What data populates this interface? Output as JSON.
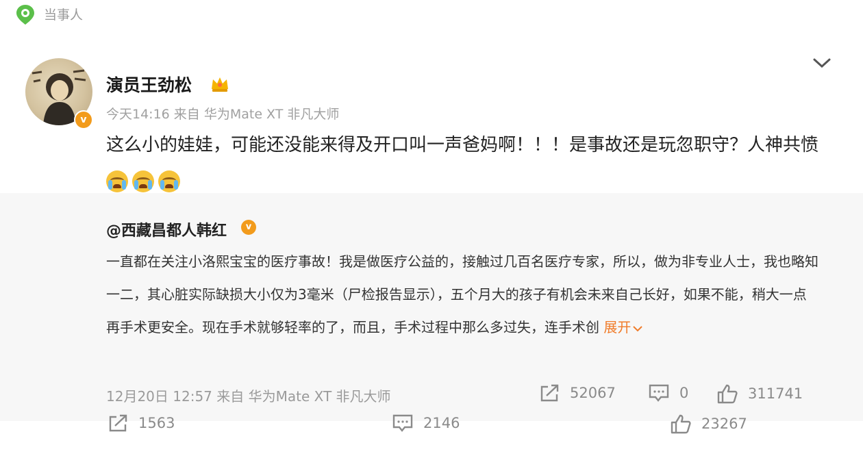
{
  "topbar": {
    "title": "当事人",
    "icon": "location-badge-icon"
  },
  "post": {
    "author": "演员王劲松",
    "meta": "今天14:16  来自 华为Mate XT 非凡大师",
    "content": "这么小的娃娃，可能还没能来得及开口叫一声爸妈啊！！！是事故还是玩忽职守？人神共愤",
    "emojis": [
      "cry-emoji",
      "cry-emoji",
      "cry-emoji"
    ],
    "repost": {
      "user": "@西藏昌都人韩红",
      "text": "一直都在关注小洛熙宝宝的医疗事故！我是做医疗公益的，接触过几百名医疗专家，所以，做为非专业人士，我也略知一二，其心脏实际缺损大小仅为3毫米（尸检报告显示），五个月大的孩子有机会未来自己长好，如果不能，稍大一点再手术更安全。现在手术就够轻率的了，而且，手术过程中那么多过失，连手术创",
      "expand_label": "展开",
      "meta": "12月20日 12:57 来自 华为Mate XT 非凡大师",
      "stats": {
        "reposts": "52067",
        "comments": "0",
        "likes": "311741"
      }
    },
    "stats": {
      "reposts": "1563",
      "comments": "2146",
      "likes": "23267"
    }
  },
  "colors": {
    "accent": "#f07c2a",
    "verified": "#f29b1c",
    "meta_gray": "#a0a0a0",
    "repost_bg": "#f7f7f7"
  }
}
